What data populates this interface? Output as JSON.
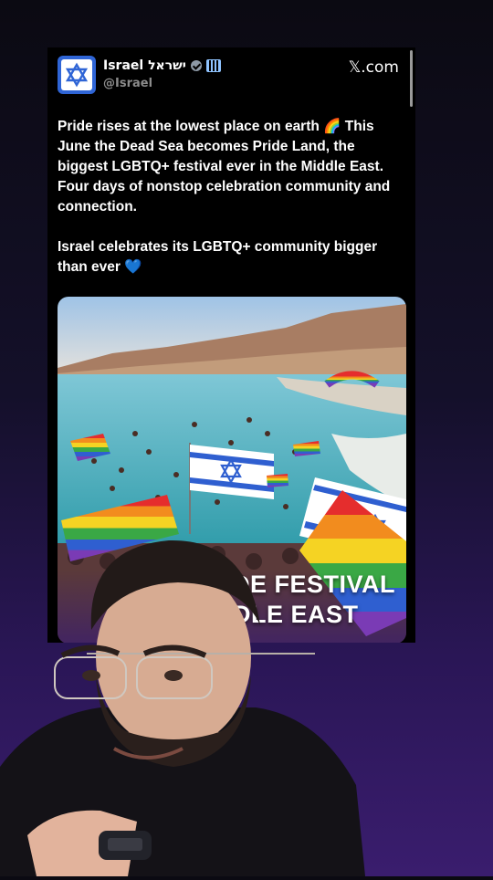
{
  "tweet": {
    "display_name": "Israel ישראל",
    "handle": "@Israel",
    "brand": "𝕏.com",
    "icons": {
      "avatar": "star-of-david-icon",
      "verified": "verified-badge-icon",
      "affiliate": "affiliate-badge-icon"
    },
    "text": "Pride rises at the lowest place on earth 🌈  This June the Dead Sea becomes Pride Land, the biggest LGBTQ+ festival ever in the Middle East. Four days of nonstop celebration community and connection.\n\nIsrael celebrates its LGBTQ+ community bigger than ever 💙",
    "image_overlay": {
      "line1": "IDE FESTIVAL",
      "line2": "DDLE EAST"
    }
  },
  "colors": {
    "accent_blue": "#2f65d6",
    "card_bg": "#000000"
  }
}
